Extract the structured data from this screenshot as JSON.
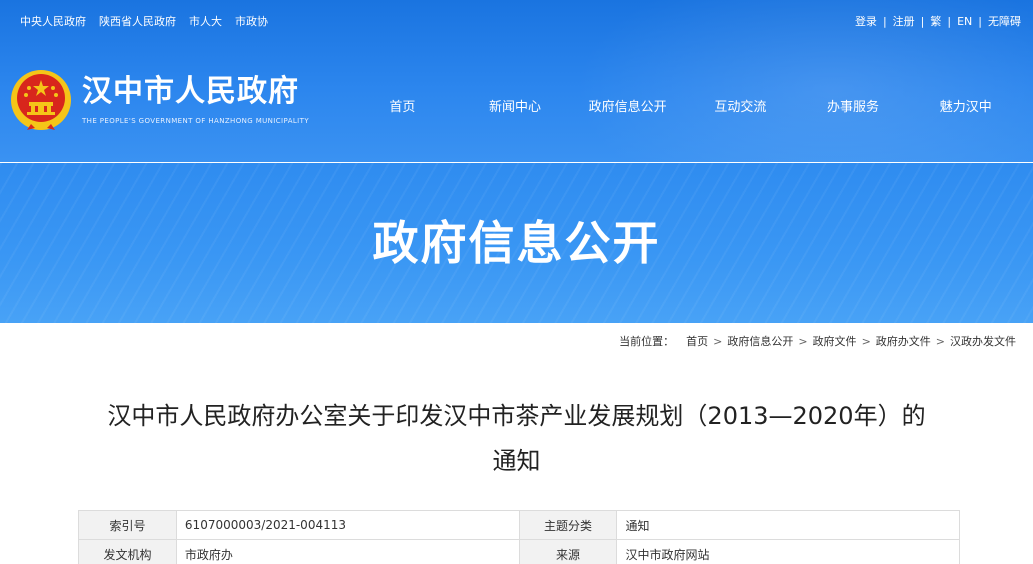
{
  "top_links": [
    "中央人民政府",
    "陕西省人民政府",
    "市人大",
    "市政协"
  ],
  "user_links": [
    "登录",
    "注册",
    "繁",
    "EN",
    "无障碍"
  ],
  "logo": {
    "title": "汉中市人民政府",
    "subtitle": "THE PEOPLE'S GOVERNMENT OF HANZHONG MUNICIPALITY"
  },
  "nav": [
    "首页",
    "新闻中心",
    "政府信息公开",
    "互动交流",
    "办事服务",
    "魅力汉中"
  ],
  "banner": {
    "title": "政府信息公开"
  },
  "breadcrumb": {
    "label": "当前位置：",
    "items": [
      "首页",
      "政府信息公开",
      "政府文件",
      "政府办文件",
      "汉政办发文件"
    ],
    "separator": ">"
  },
  "article": {
    "title_line1": "汉中市人民政府办公室关于印发汉中市茶产业发展规划（2013—2020年）的",
    "title_line2": "通知"
  },
  "meta": {
    "rows": [
      {
        "k1": "索引号",
        "v1": "6107000003/2021-004113",
        "k2": "主题分类",
        "v2": "通知"
      },
      {
        "k1": "发文机构",
        "v1": "市政府办",
        "k2": "来源",
        "v2": "汉中市政府网站"
      }
    ]
  },
  "colors": {
    "header_blue": "#1a74e0",
    "banner_blue": "#3a97f4",
    "emblem_red": "#d8261c",
    "emblem_gold": "#f5c518"
  }
}
